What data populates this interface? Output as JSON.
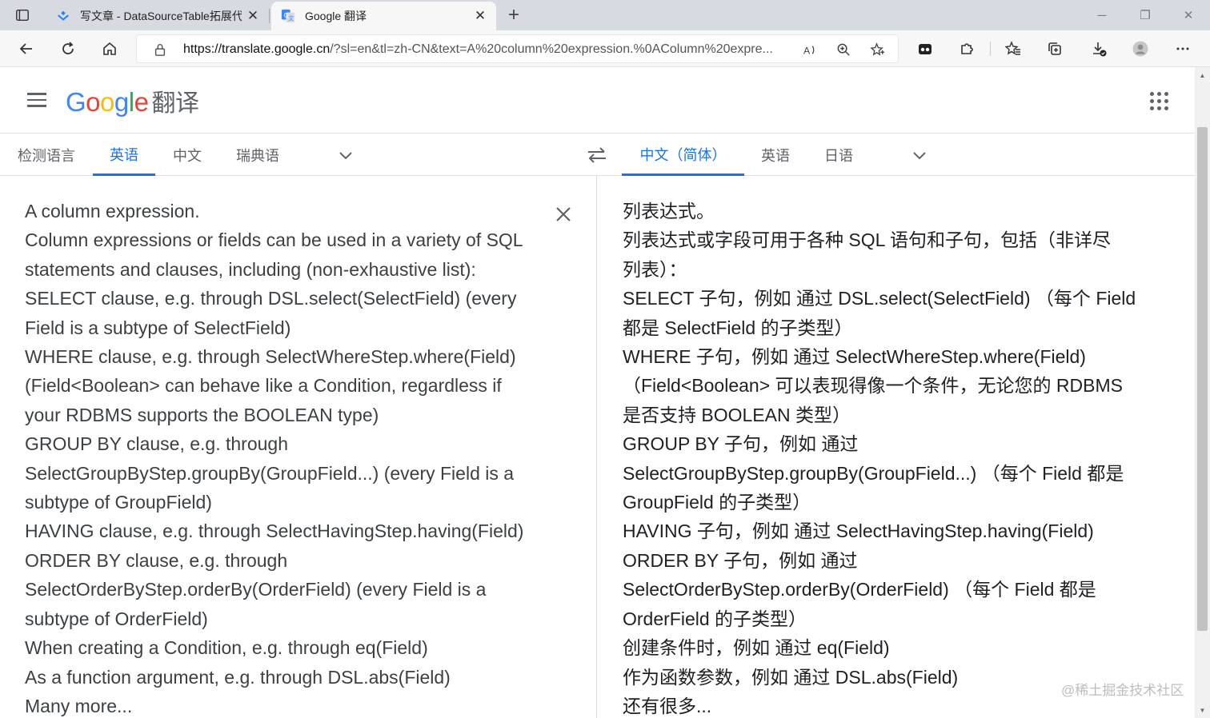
{
  "browser": {
    "tabs": [
      {
        "title": "写文章 - DataSourceTable拓展代",
        "active": false
      },
      {
        "title": "Google 翻译",
        "active": true
      }
    ],
    "url_host": "https://translate.google.cn",
    "url_path": "/?sl=en&tl=zh-CN&text=A%20column%20expression.%0AColumn%20expre...",
    "icons": [
      "tab-actions-icon",
      "back-icon",
      "refresh-icon",
      "home-icon",
      "lock-icon",
      "read-aloud-icon",
      "zoom-icon",
      "add-favorite-icon",
      "extension-icon",
      "puzzle-icon",
      "favorites-icon",
      "collections-icon",
      "downloads-icon",
      "profile-icon",
      "more-icon"
    ]
  },
  "header": {
    "logo_letters": [
      "G",
      "o",
      "o",
      "g",
      "l",
      "e"
    ],
    "product": "翻译",
    "colors": {
      "blue": "#4285f4",
      "red": "#ea4335",
      "yellow": "#fbbc05",
      "green": "#34a853",
      "accent": "#1a73e8"
    }
  },
  "source_langs": [
    "检测语言",
    "英语",
    "中文",
    "瑞典语"
  ],
  "source_active": "英语",
  "target_langs": [
    "中文（简体）",
    "英语",
    "日语"
  ],
  "target_active": "中文（简体）",
  "source_lines": [
    "A column expression.",
    "Column expressions or fields can be used in a variety of SQL",
    "statements and clauses, including (non-exhaustive list):",
    "SELECT clause, e.g. through DSL.select(SelectField) (every",
    "Field is a subtype of SelectField)",
    "WHERE clause, e.g. through SelectWhereStep.where(Field)",
    "(Field<Boolean> can behave like a Condition, regardless if",
    "your RDBMS supports the BOOLEAN type)",
    "GROUP BY clause, e.g. through",
    "SelectGroupByStep.groupBy(GroupField...) (every Field is a",
    "subtype of GroupField)",
    "HAVING clause, e.g. through SelectHavingStep.having(Field)",
    "ORDER BY clause, e.g. through",
    "SelectOrderByStep.orderBy(OrderField) (every Field is a",
    "subtype of OrderField)",
    "When creating a Condition, e.g. through eq(Field)",
    "As a function argument, e.g. through DSL.abs(Field)",
    "Many more..."
  ],
  "target_lines": [
    "列表达式。",
    "列表达式或字段可用于各种 SQL 语句和子句，包括（非详尽",
    "列表）：",
    "SELECT 子句，例如 通过 DSL.select(SelectField) （每个 Field",
    "都是 SelectField 的子类型）",
    "WHERE 子句，例如 通过 SelectWhereStep.where(Field)",
    "（Field<Boolean> 可以表现得像一个条件，无论您的 RDBMS",
    "是否支持 BOOLEAN 类型）",
    "GROUP BY 子句，例如 通过",
    "SelectGroupByStep.groupBy(GroupField...) （每个 Field 都是",
    "GroupField 的子类型）",
    "HAVING 子句，例如 通过 SelectHavingStep.having(Field)",
    "ORDER BY 子句，例如 通过",
    "SelectOrderByStep.orderBy(OrderField) （每个 Field 都是",
    "OrderField 的子类型）",
    "创建条件时，例如 通过 eq(Field)",
    "作为函数参数，例如 通过 DSL.abs(Field)",
    "还有很多..."
  ],
  "watermark": "@稀土掘金技术社区"
}
